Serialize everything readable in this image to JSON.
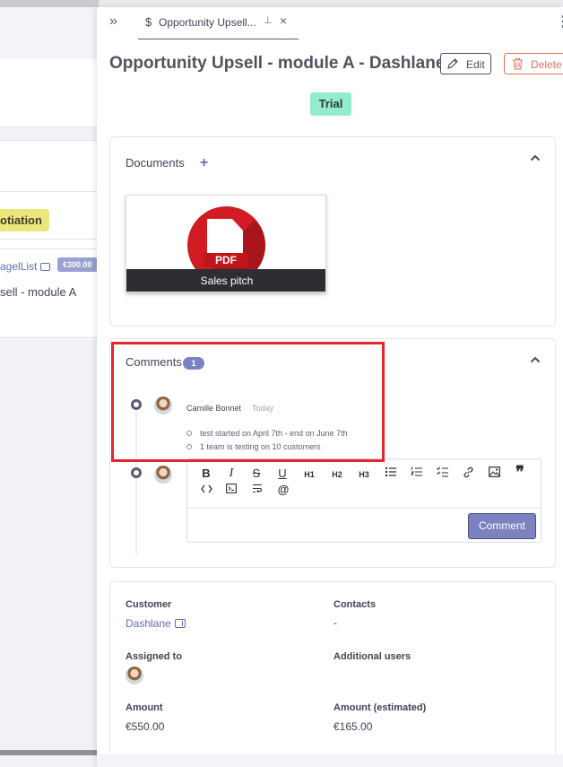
{
  "background": {
    "status_tag": "otiation",
    "list_link": "agelList",
    "price_badge": "€300.00",
    "opportunity_text": "sell - module A"
  },
  "drawer": {
    "tab": {
      "icon": "dollar-icon",
      "label": "Opportunity Upsell..."
    },
    "title": "Opportunity Upsell - module A - Dashlane",
    "actions": {
      "edit_label": "Edit",
      "delete_label": "Delete"
    },
    "status": "Trial"
  },
  "documents": {
    "title": "Documents",
    "add_symbol": "+",
    "items": [
      {
        "type": "PDF",
        "caption": "Sales pitch"
      }
    ]
  },
  "comments": {
    "title": "Comments",
    "count": "1",
    "items": [
      {
        "author": "Camille Bonnet",
        "time": "Today",
        "lines": [
          "test started on April 7th - end on June 7th",
          "1 team is testing on 10 customers"
        ]
      }
    ],
    "editor": {
      "toolbar": [
        "B",
        "I",
        "S",
        "U",
        "H1",
        "H2",
        "H3",
        "bulleted-list",
        "numbered-list",
        "checklist",
        "link",
        "image",
        "quote",
        "code",
        "code-block",
        "wrap",
        "mention"
      ],
      "submit_label": "Comment"
    }
  },
  "info": {
    "customer_label": "Customer",
    "customer_value": "Dashlane",
    "contacts_label": "Contacts",
    "contacts_value": "-",
    "assigned_label": "Assigned to",
    "additional_label": "Additional users",
    "amount_label": "Amount",
    "amount_value": "€550.00",
    "amount_est_label": "Amount (estimated)",
    "amount_est_value": "€165.00"
  },
  "colors": {
    "accent": "#7c81bf",
    "status_trial": "#94eccf",
    "delete": "#e0735d",
    "highlight": "#e6262d",
    "pdf_red": "#d11c23"
  }
}
